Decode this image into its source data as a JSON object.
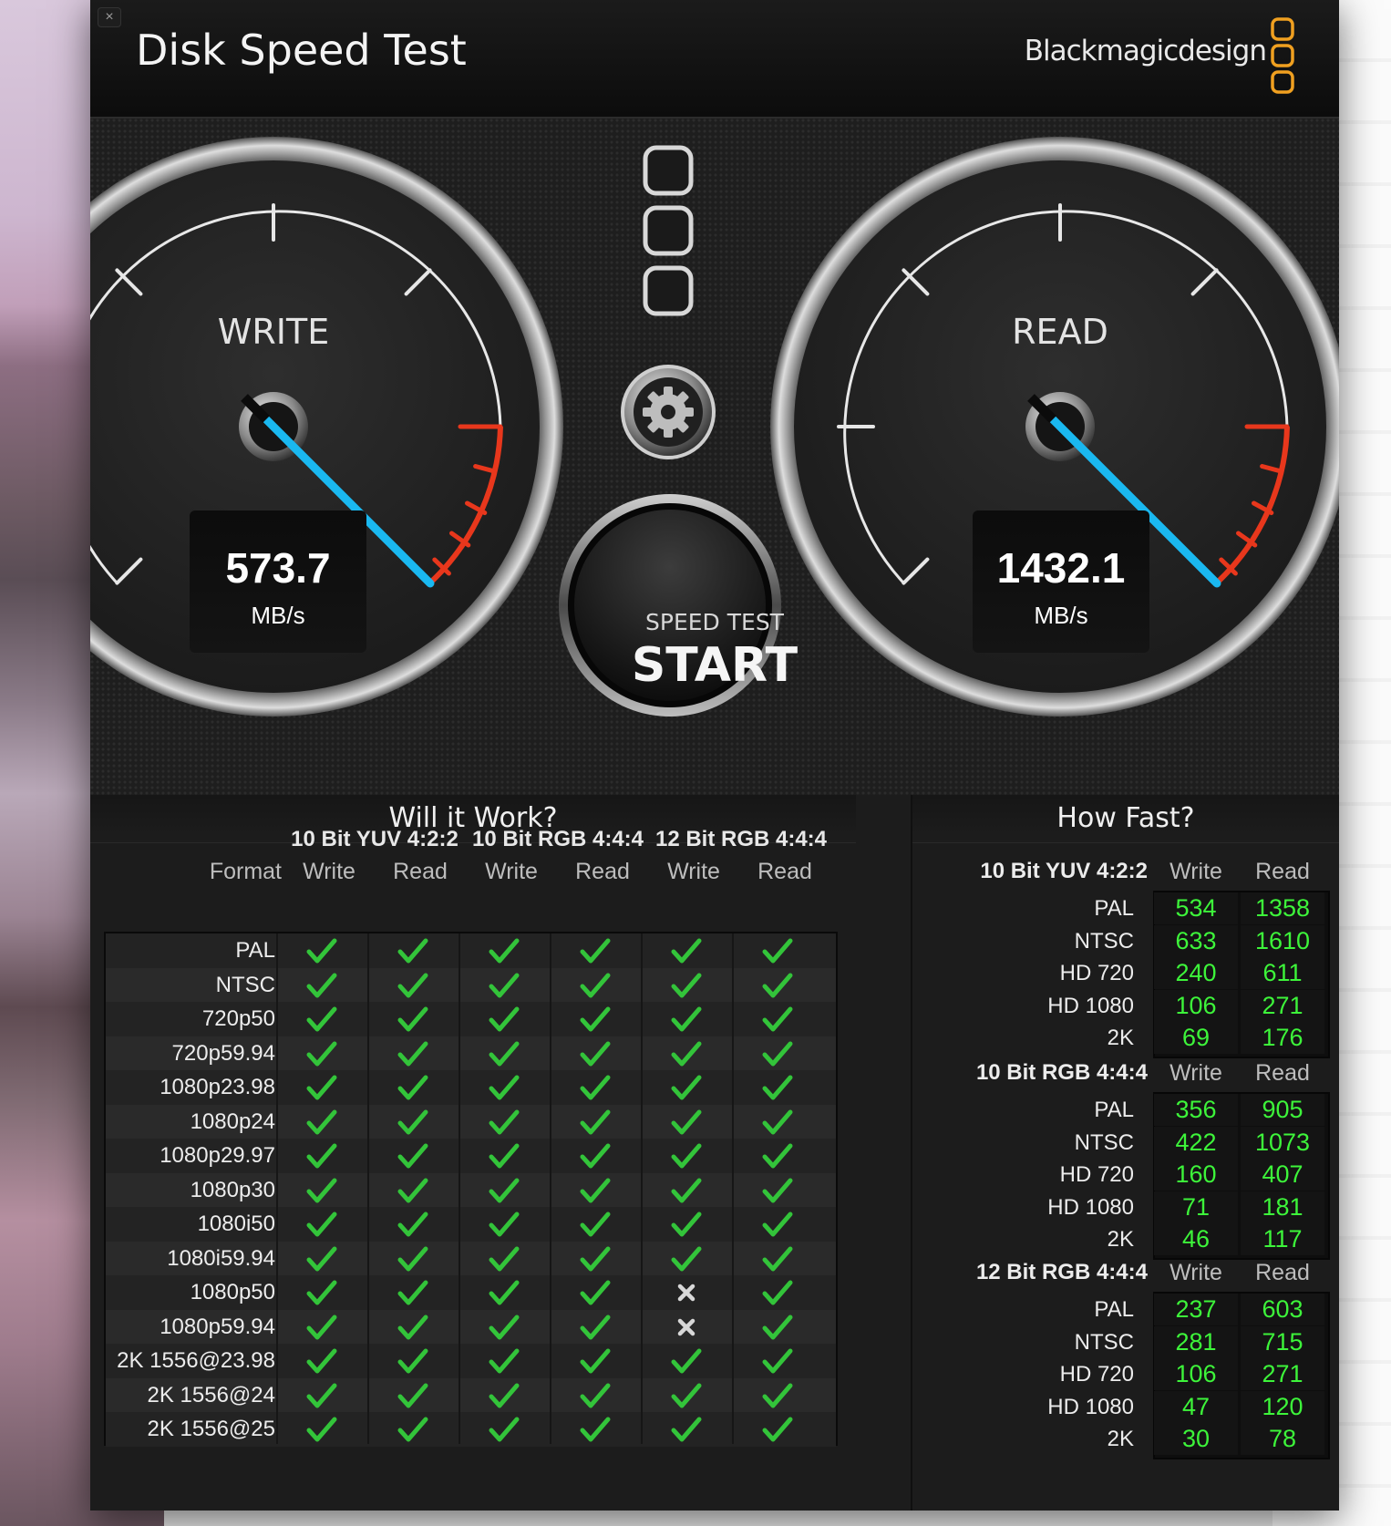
{
  "window": {
    "close_glyph": "×",
    "title": "Disk Speed Test",
    "brand": "Blackmagicdesign"
  },
  "gauges": {
    "write": {
      "label": "WRITE",
      "value": "573.7",
      "unit": "MB/s"
    },
    "read": {
      "label": "READ",
      "value": "1432.1",
      "unit": "MB/s"
    },
    "needle_color": "#1ab8f0",
    "redline_color": "#e8371c"
  },
  "start_button": {
    "small_label": "SPEED TEST",
    "big_label": "START"
  },
  "will_it_work": {
    "title": "Will it Work?",
    "format_label": "Format",
    "groups": [
      "10 Bit YUV 4:2:2",
      "10 Bit RGB 4:4:4",
      "12 Bit RGB 4:4:4"
    ],
    "subcolumns": [
      "Write",
      "Read",
      "Write",
      "Read",
      "Write",
      "Read"
    ],
    "rows": [
      {
        "format": "PAL",
        "results": [
          "check",
          "check",
          "check",
          "check",
          "check",
          "check"
        ]
      },
      {
        "format": "NTSC",
        "results": [
          "check",
          "check",
          "check",
          "check",
          "check",
          "check"
        ]
      },
      {
        "format": "720p50",
        "results": [
          "check",
          "check",
          "check",
          "check",
          "check",
          "check"
        ]
      },
      {
        "format": "720p59.94",
        "results": [
          "check",
          "check",
          "check",
          "check",
          "check",
          "check"
        ]
      },
      {
        "format": "1080p23.98",
        "results": [
          "check",
          "check",
          "check",
          "check",
          "check",
          "check"
        ]
      },
      {
        "format": "1080p24",
        "results": [
          "check",
          "check",
          "check",
          "check",
          "check",
          "check"
        ]
      },
      {
        "format": "1080p29.97",
        "results": [
          "check",
          "check",
          "check",
          "check",
          "check",
          "check"
        ]
      },
      {
        "format": "1080p30",
        "results": [
          "check",
          "check",
          "check",
          "check",
          "check",
          "check"
        ]
      },
      {
        "format": "1080i50",
        "results": [
          "check",
          "check",
          "check",
          "check",
          "check",
          "check"
        ]
      },
      {
        "format": "1080i59.94",
        "results": [
          "check",
          "check",
          "check",
          "check",
          "check",
          "check"
        ]
      },
      {
        "format": "1080p50",
        "results": [
          "check",
          "check",
          "check",
          "check",
          "cross",
          "check"
        ]
      },
      {
        "format": "1080p59.94",
        "results": [
          "check",
          "check",
          "check",
          "check",
          "cross",
          "check"
        ]
      },
      {
        "format": "2K 1556@23.98",
        "results": [
          "check",
          "check",
          "check",
          "check",
          "check",
          "check"
        ]
      },
      {
        "format": "2K 1556@24",
        "results": [
          "check",
          "check",
          "check",
          "check",
          "check",
          "check"
        ]
      },
      {
        "format": "2K 1556@25",
        "results": [
          "check",
          "check",
          "check",
          "check",
          "check",
          "check"
        ]
      }
    ],
    "check_color": "#33c43a",
    "cross_color": "#d8d8d8"
  },
  "how_fast": {
    "title": "How Fast?",
    "sections": [
      {
        "title": "10 Bit YUV 4:2:2",
        "write_label": "Write",
        "read_label": "Read",
        "rows": [
          {
            "format": "PAL",
            "write": "534",
            "read": "1358"
          },
          {
            "format": "NTSC",
            "write": "633",
            "read": "1610"
          },
          {
            "format": "HD 720",
            "write": "240",
            "read": "611"
          },
          {
            "format": "HD 1080",
            "write": "106",
            "read": "271"
          },
          {
            "format": "2K",
            "write": "69",
            "read": "176"
          }
        ]
      },
      {
        "title": "10 Bit RGB 4:4:4",
        "write_label": "Write",
        "read_label": "Read",
        "rows": [
          {
            "format": "PAL",
            "write": "356",
            "read": "905"
          },
          {
            "format": "NTSC",
            "write": "422",
            "read": "1073"
          },
          {
            "format": "HD 720",
            "write": "160",
            "read": "407"
          },
          {
            "format": "HD 1080",
            "write": "71",
            "read": "181"
          },
          {
            "format": "2K",
            "write": "46",
            "read": "117"
          }
        ]
      },
      {
        "title": "12 Bit RGB 4:4:4",
        "write_label": "Write",
        "read_label": "Read",
        "rows": [
          {
            "format": "PAL",
            "write": "237",
            "read": "603"
          },
          {
            "format": "NTSC",
            "write": "281",
            "read": "715"
          },
          {
            "format": "HD 720",
            "write": "106",
            "read": "271"
          },
          {
            "format": "HD 1080",
            "write": "47",
            "read": "120"
          },
          {
            "format": "2K",
            "write": "30",
            "read": "78"
          }
        ]
      }
    ],
    "value_color": "#3df43a"
  },
  "icons": {
    "logo": "blackmagic-three-squares-icon",
    "settings": "gear-icon",
    "pass": "checkmark-icon",
    "fail": "x-icon"
  },
  "accent_color": "#f0a020"
}
